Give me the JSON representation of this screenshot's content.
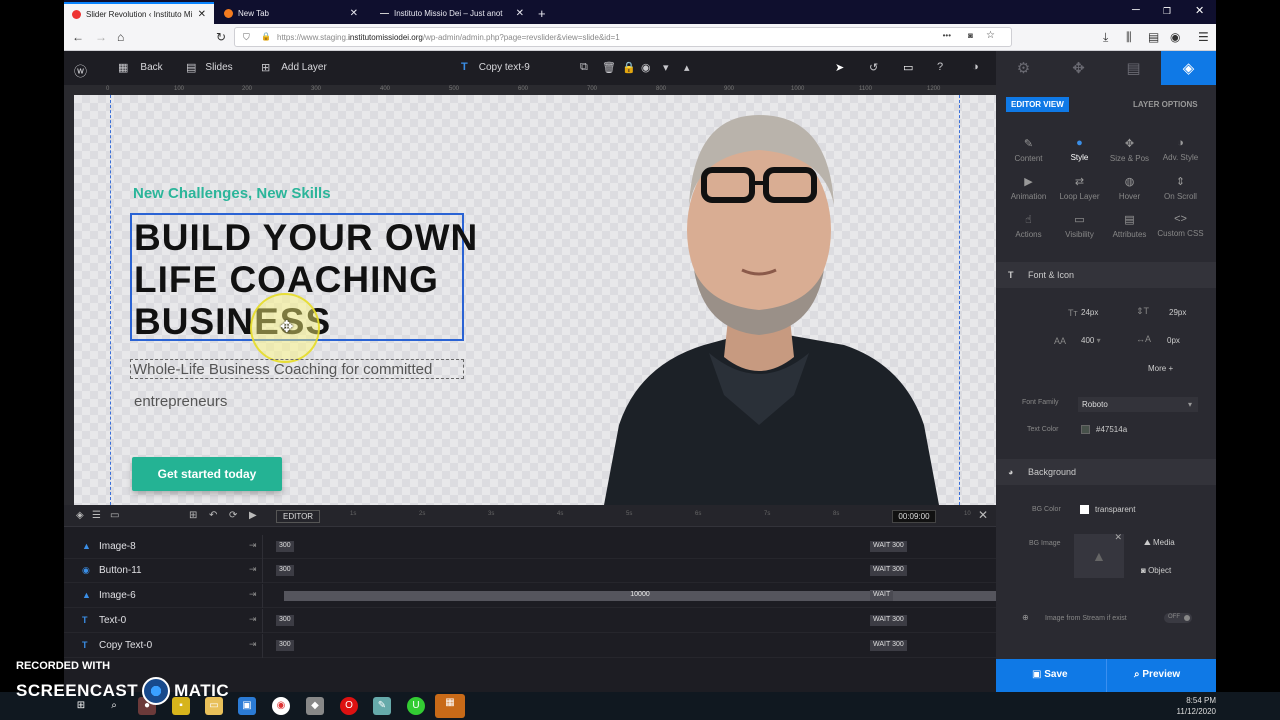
{
  "browser": {
    "tabs": [
      {
        "label": "Slider Revolution ‹ Instituto Mi",
        "active": true
      },
      {
        "label": "New Tab",
        "active": false
      },
      {
        "label": "Instituto Missio Dei – Just anot",
        "active": false
      }
    ],
    "url_prefix": "https://www.staging.",
    "url_domain": "institutomissiodei.org",
    "url_path": "/wp-admin/admin.php?page=revslider&view=slide&id=1"
  },
  "toolbar": {
    "back": "Back",
    "slides": "Slides",
    "add_layer": "Add Layer",
    "layer_name": "Copy text-9"
  },
  "ruler": [
    "0",
    "100",
    "200",
    "300",
    "400",
    "500",
    "600",
    "700",
    "800",
    "900",
    "1000",
    "1100",
    "1200"
  ],
  "slide": {
    "eyebrow": "New Challenges, New Skills",
    "headline": [
      "BUILD YOUR OWN",
      "LIFE COACHING",
      "BUSINESS"
    ],
    "subtitle_line1": "Whole-Life Business Coaching for committed",
    "subtitle_line2": "entrepreneurs",
    "cta": "Get started today"
  },
  "timeline": {
    "mode": "EDITOR",
    "ticks": [
      "1s",
      "2s",
      "3s",
      "4s",
      "5s",
      "6s",
      "7s",
      "8s",
      "9s"
    ],
    "time": "00:09:00",
    "ruler_end": "10",
    "wait_label": "WAIT",
    "layers": [
      {
        "name": "Image-8",
        "icon": "image",
        "start": "300",
        "end": "300"
      },
      {
        "name": "Button-11",
        "icon": "button",
        "start": "300",
        "end": "300"
      },
      {
        "name": "Image-6",
        "icon": "image",
        "start": "",
        "duration": "10000",
        "end": ""
      },
      {
        "name": "Text-0",
        "icon": "text",
        "start": "300",
        "end": "300"
      },
      {
        "name": "Copy Text-0",
        "icon": "text",
        "start": "300",
        "end": "300"
      }
    ]
  },
  "panel": {
    "editor_view": "EDITOR VIEW",
    "layer_options": "LAYER OPTIONS",
    "grid": [
      {
        "label": "Content",
        "icon": "pencil-icon"
      },
      {
        "label": "Style",
        "icon": "palette-icon",
        "active": true
      },
      {
        "label": "Size & Pos",
        "icon": "move-icon"
      },
      {
        "label": "Adv. Style",
        "icon": "contrast-icon"
      },
      {
        "label": "Animation",
        "icon": "play-icon"
      },
      {
        "label": "Loop Layer",
        "icon": "loop-icon"
      },
      {
        "label": "Hover",
        "icon": "mouse-icon"
      },
      {
        "label": "On Scroll",
        "icon": "scroll-icon"
      },
      {
        "label": "Actions",
        "icon": "hand-icon"
      },
      {
        "label": "Visibility",
        "icon": "eye-icon"
      },
      {
        "label": "Attributes",
        "icon": "doc-icon"
      },
      {
        "label": "Custom CSS",
        "icon": "code-icon"
      }
    ],
    "font_section": "Font & Icon",
    "font_size": "24px",
    "line_height": "29px",
    "font_weight": "400",
    "letter_spacing": "0px",
    "more": "More",
    "font_family_label": "Font Family",
    "font_family": "Roboto",
    "text_color_label": "Text Color",
    "text_color": "#47514a",
    "bg_section": "Background",
    "bg_color_label": "BG Color",
    "bg_color": "transparent",
    "bg_image_label": "BG Image",
    "media": "Media",
    "object": "Object",
    "stream_label": "Image from Stream if exist",
    "stream_toggle": "OFF",
    "save": "Save",
    "preview": "Preview"
  },
  "taskbar": {
    "time": "8:54 PM",
    "date": "11/12/2020"
  },
  "watermark": {
    "line1": "RECORDED WITH",
    "line2a": "SCREENCAST",
    "line2b": "MATIC"
  },
  "colors": {
    "accent": "#0f79e6",
    "teal": "#24b394",
    "toolbar_bg": "#1d1d23"
  }
}
